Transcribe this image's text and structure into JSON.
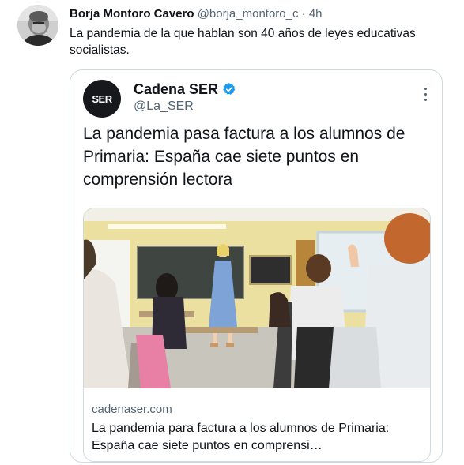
{
  "tweet": {
    "author_name": "Borja Montoro Cavero",
    "author_handle": "@borja_montoro_c",
    "separator": "·",
    "time": "4h",
    "text": "La pandemia de la que hablan son 40 años de leyes educativas socialistas."
  },
  "quoted": {
    "logo_text": "SER",
    "name": "Cadena SER",
    "handle": "@La_SER",
    "text": "La pandemia pasa factura a los alumnos de Primaria: España cae siete puntos en comprensión lectora",
    "card": {
      "domain": "cadenaser.com",
      "title": "La pandemia para factura a los alumnos de Primaria: España cae siete puntos en comprensi…"
    }
  },
  "colors": {
    "text": "#0f1419",
    "secondary": "#536471",
    "border": "#cfd9de",
    "verified": "#1d9bf0"
  }
}
